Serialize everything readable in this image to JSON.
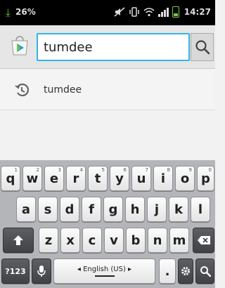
{
  "status_bar": {
    "download_glyph": "⤓",
    "battery_percent": "26%",
    "time": "14:27",
    "icons": [
      "mute-icon",
      "vibrate-icon",
      "wifi-icon",
      "signal-icon",
      "battery-icon"
    ]
  },
  "search": {
    "query": "tumdee",
    "app_icon": "play-store-icon",
    "button_icon": "magnifier-icon"
  },
  "suggestions": [
    {
      "label": "tumdee",
      "icon": "history-icon"
    }
  ],
  "keyboard": {
    "row1": [
      {
        "key": "q",
        "hint": "1"
      },
      {
        "key": "w",
        "hint": "2"
      },
      {
        "key": "e",
        "hint": "3"
      },
      {
        "key": "r",
        "hint": "4"
      },
      {
        "key": "t",
        "hint": "5"
      },
      {
        "key": "y",
        "hint": "6"
      },
      {
        "key": "u",
        "hint": "7"
      },
      {
        "key": "i",
        "hint": "8"
      },
      {
        "key": "o",
        "hint": "9"
      },
      {
        "key": "p",
        "hint": "0"
      }
    ],
    "row2": [
      "a",
      "s",
      "d",
      "f",
      "g",
      "h",
      "j",
      "k",
      "l"
    ],
    "row3": [
      "z",
      "x",
      "c",
      "v",
      "b",
      "n",
      "m"
    ],
    "symbols_label": "?123",
    "language_label": "English (US)",
    "period": ".",
    "accent_color": "#33b5e5"
  }
}
